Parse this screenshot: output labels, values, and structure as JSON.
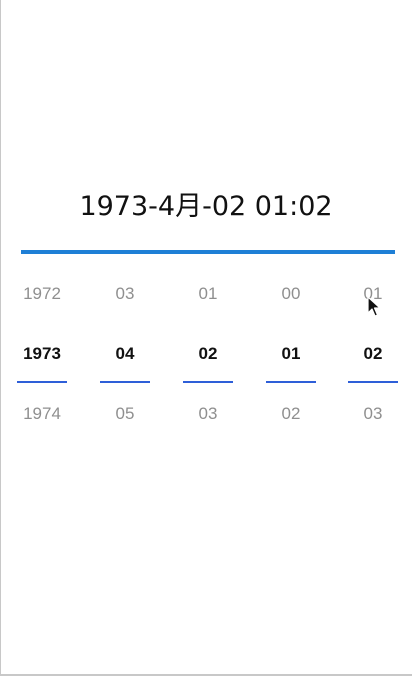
{
  "title": "1973-4月-02 01:02",
  "picker": {
    "columns": [
      {
        "id": "year",
        "prev": "1972",
        "selected": "1973",
        "next": "1974"
      },
      {
        "id": "month",
        "prev": "03",
        "selected": "04",
        "next": "05"
      },
      {
        "id": "day",
        "prev": "01",
        "selected": "02",
        "next": "03"
      },
      {
        "id": "hour",
        "prev": "00",
        "selected": "01",
        "next": "02"
      },
      {
        "id": "minute",
        "prev": "01",
        "selected": "02",
        "next": "03"
      }
    ]
  },
  "colors": {
    "accent_bar": "#1e7fd6",
    "selection_underline": "#2e5fd8",
    "selected_text": "#111111",
    "unselected_text": "#8f8f8f"
  },
  "icons": {
    "cursor": "mouse-pointer-icon"
  }
}
